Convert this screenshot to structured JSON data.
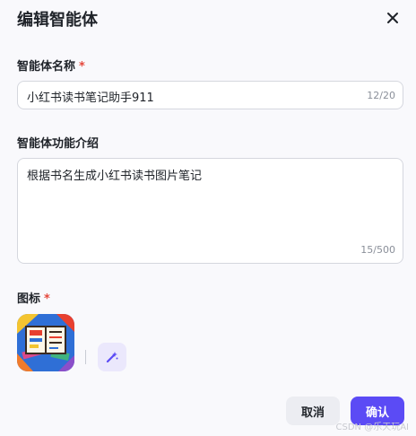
{
  "dialog": {
    "title": "编辑智能体"
  },
  "fields": {
    "name": {
      "label": "智能体名称",
      "required_mark": "*",
      "value": "小红书读书笔记助手911",
      "counter": "12/20"
    },
    "description": {
      "label": "智能体功能介绍",
      "value": "根据书名生成小红书读书图片笔记",
      "counter": "15/500"
    },
    "icon": {
      "label": "图标",
      "required_mark": "*"
    }
  },
  "footer": {
    "cancel_label": "取消",
    "confirm_label": "确认"
  },
  "watermark": "CSDN @乐天玩AI",
  "colors": {
    "primary": "#5b4bf5",
    "required": "#e5483c",
    "ai_button_bg": "#ebe8fc"
  }
}
